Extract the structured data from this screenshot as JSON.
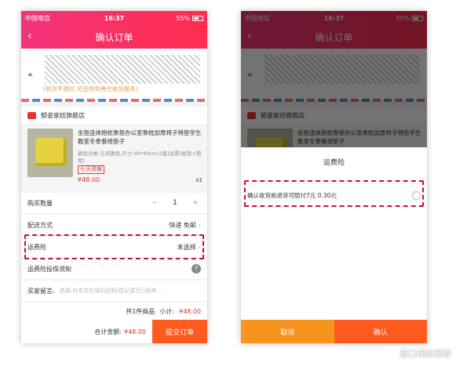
{
  "status": {
    "carrier": "中国电信",
    "time": "16:37",
    "battery": "55%"
  },
  "nav": {
    "title": "确认订单",
    "back_icon": "chevron-left-icon"
  },
  "address": {
    "hint": "(收货不便时,可选择免费代收货服务)"
  },
  "shop": {
    "name": "郁姿家纺旗舰店"
  },
  "product": {
    "title": "坐垫连体抱枕靠垫办公室靠枕加厚椅子椅垫学生教室冬季餐椅垫子",
    "spec": "颜色分类:几何黄色,尺寸:40*40cm(2套(加厚)坐垫+抱枕)",
    "tag": "七天退换",
    "price": "¥48.00",
    "qty_label": "x1"
  },
  "rows": {
    "quantity_label": "购买数量",
    "quantity_value": "1",
    "minus": "−",
    "plus": "+",
    "shipping_label": "配送方式",
    "shipping_value": "快递 免邮",
    "insurance_label": "运费险",
    "insurance_value": "未选择",
    "insurance_notice_label": "运费险投保须知",
    "memo_label": "买家留言:",
    "memo_placeholder": "选填:对本次交易的说明(建议填写已和卖...",
    "subtotal_count": "共1件商品",
    "subtotal_label": "小计:",
    "subtotal_value": "¥48.00"
  },
  "bottom": {
    "total_label": "合计金额:",
    "total_value": "¥48.00",
    "submit": "提交订单"
  },
  "sheet": {
    "title": "运费险",
    "option": "确认收货前退货可赔付7元 0.30元",
    "cancel": "取消",
    "confirm": "确认"
  },
  "watermark": {
    "text": "道口保险观察"
  },
  "colors": {
    "brand_gradient_start": "#f2337a",
    "brand_gradient_end": "#ff2d4f",
    "price": "#e8322f",
    "submit": "#ff5a1e",
    "cancel": "#f7941d",
    "highlight": "#c8102e"
  }
}
